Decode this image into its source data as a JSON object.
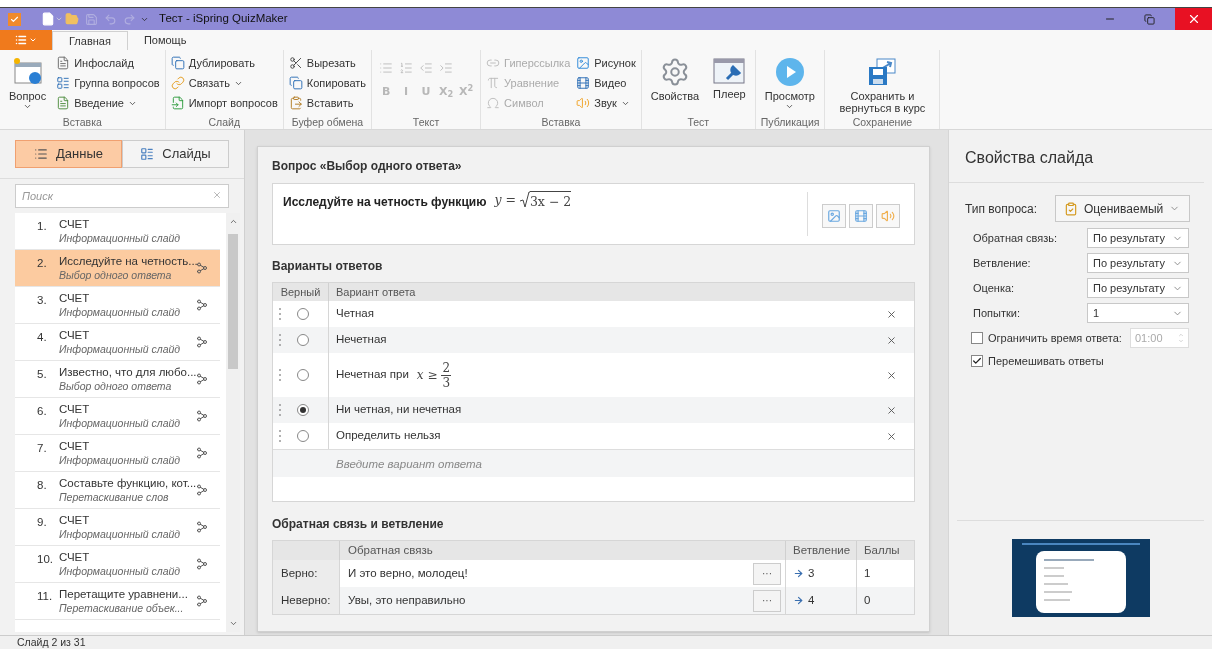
{
  "window": {
    "title": "Тест - iSpring QuizMaker"
  },
  "ribbon_tabs": [
    {
      "label": "Главная",
      "selected": true
    },
    {
      "label": "Помощь",
      "selected": false
    }
  ],
  "ribbon_groups": [
    {
      "label": "Вставка",
      "columns": [
        [
          {
            "kind": "large",
            "label": "Вопрос",
            "menu": true,
            "disabled": false
          }
        ],
        [
          {
            "kind": "small",
            "label": "Инфослайд",
            "menu": false,
            "disabled": false
          },
          {
            "kind": "small",
            "label": "Группа вопросов",
            "menu": false,
            "disabled": false
          },
          {
            "kind": "small",
            "label": "Введение",
            "menu": true,
            "disabled": false
          }
        ]
      ]
    },
    {
      "label": "Слайд",
      "columns": [
        [
          {
            "kind": "small",
            "label": "Дублировать",
            "menu": false,
            "disabled": false
          },
          {
            "kind": "small",
            "label": "Связать",
            "menu": true,
            "disabled": false
          },
          {
            "kind": "small",
            "label": "Импорт вопросов",
            "menu": false,
            "disabled": false
          }
        ]
      ]
    },
    {
      "label": "Буфер обмена",
      "columns": [
        [
          {
            "kind": "small",
            "label": "Вырезать",
            "menu": false,
            "disabled": false
          },
          {
            "kind": "small",
            "label": "Копировать",
            "menu": false,
            "disabled": false
          },
          {
            "kind": "small",
            "label": "Вставить",
            "menu": false,
            "disabled": false
          }
        ]
      ]
    },
    {
      "label": "Текст",
      "rows": [
        [
          {
            "kind": "icon",
            "disabled": true
          },
          {
            "kind": "icon",
            "disabled": true
          },
          {
            "kind": "icon",
            "disabled": true
          },
          {
            "kind": "icon",
            "disabled": true
          }
        ],
        [
          {
            "kind": "glyph",
            "label": "B",
            "disabled": true
          },
          {
            "kind": "glyph",
            "label": "I",
            "disabled": true
          },
          {
            "kind": "glyph",
            "label": "U",
            "disabled": true
          },
          {
            "kind": "glyph",
            "label": "X$_{2}$",
            "disabled": true
          },
          {
            "kind": "glyph",
            "label": "X$^{2}$",
            "disabled": true
          }
        ]
      ]
    },
    {
      "label": "Вставка",
      "columns": [
        [
          {
            "kind": "small",
            "label": "Гиперссылка",
            "menu": false,
            "disabled": true
          },
          {
            "kind": "small",
            "label": "Уравнение",
            "menu": false,
            "disabled": true
          },
          {
            "kind": "small",
            "label": "Символ",
            "menu": false,
            "disabled": true
          }
        ],
        [
          {
            "kind": "small",
            "label": "Рисунок",
            "menu": false,
            "disabled": false
          },
          {
            "kind": "small",
            "label": "Видео",
            "menu": false,
            "disabled": false
          },
          {
            "kind": "small",
            "label": "Звук",
            "menu": true,
            "disabled": false
          }
        ]
      ]
    },
    {
      "label": "Тест",
      "columns": [
        [
          {
            "kind": "large",
            "label": "Свойства",
            "menu": false,
            "disabled": false
          }
        ],
        [
          {
            "kind": "large",
            "label": "Плеер",
            "menu": false,
            "disabled": false
          }
        ]
      ]
    },
    {
      "label": "Публикация",
      "columns": [
        [
          {
            "kind": "large",
            "label": "Просмотр",
            "menu": true,
            "disabled": false
          }
        ]
      ]
    },
    {
      "label": "Сохранение",
      "columns": [
        [
          {
            "kind": "large",
            "label": "Сохранить и вернуться в курс",
            "menu": false,
            "disabled": false
          }
        ]
      ]
    }
  ],
  "left_tabs": [
    {
      "label": "Данные",
      "selected": true
    },
    {
      "label": "Слайды",
      "selected": false
    }
  ],
  "search": {
    "placeholder": "Поиск"
  },
  "slides": [
    {
      "number": "1.",
      "title": "СЧЕТ",
      "subtitle": "Информационный слайд",
      "selected": false,
      "branching": false
    },
    {
      "number": "2.",
      "title": "Исследуйте на четность...",
      "subtitle": "Выбор одного ответа",
      "selected": true,
      "branching": true
    },
    {
      "number": "3.",
      "title": "СЧЕТ",
      "subtitle": "Информационный слайд",
      "selected": false,
      "branching": true
    },
    {
      "number": "4.",
      "title": "СЧЕТ",
      "subtitle": "Информационный слайд",
      "selected": false,
      "branching": true
    },
    {
      "number": "5.",
      "title": "Известно, что для любо...",
      "subtitle": "Выбор одного ответа",
      "selected": false,
      "branching": true
    },
    {
      "number": "6.",
      "title": "СЧЕТ",
      "subtitle": "Информационный слайд",
      "selected": false,
      "branching": true
    },
    {
      "number": "7.",
      "title": "СЧЕТ",
      "subtitle": "Информационный слайд",
      "selected": false,
      "branching": true
    },
    {
      "number": "8.",
      "title": "Составьте функцию, кот...",
      "subtitle": "Перетаскивание слов",
      "selected": false,
      "branching": true
    },
    {
      "number": "9.",
      "title": "СЧЕТ",
      "subtitle": "Информационный слайд",
      "selected": false,
      "branching": true
    },
    {
      "number": "10.",
      "title": "СЧЕТ",
      "subtitle": "Информационный слайд",
      "selected": false,
      "branching": true
    },
    {
      "number": "11.",
      "title": "Перетащите уравнени...",
      "subtitle": "Перетаскивание объек...",
      "selected": false,
      "branching": true
    }
  ],
  "editor": {
    "title": "Вопрос «Выбор одного ответа»",
    "question": {
      "text": "Исследуйте на четность функцию",
      "formula": "y =",
      "radicand": "3x − 2"
    },
    "answers_title": "Варианты ответов",
    "answer_columns": [
      "Верный",
      "Вариант ответа"
    ],
    "answers": [
      {
        "kind": "text",
        "text": "Четная",
        "selected": false
      },
      {
        "kind": "text",
        "text": "Нечетная",
        "selected": false
      },
      {
        "kind": "fraction",
        "text": "Нечетная при",
        "formula": "x ≥",
        "numerator": "2",
        "denominator": "3",
        "selected": false
      },
      {
        "kind": "text",
        "text": "Ни четная, ни нечетная",
        "selected": true
      },
      {
        "kind": "text",
        "text": "Определить нельзя",
        "selected": false
      }
    ],
    "new_answer": {
      "placeholder": "Введите вариант ответа"
    },
    "feedback_title": "Обратная связь и ветвление",
    "feedback_columns": [
      "Обратная связь",
      "Ветвление",
      "Баллы"
    ],
    "feedback": [
      {
        "label": "Верно:",
        "text": "И это верно, молодец!",
        "branch": "3",
        "score": "1"
      },
      {
        "label": "Неверно:",
        "text": "Увы, это неправильно",
        "branch": "4",
        "score": "0"
      }
    ],
    "more_button": "···"
  },
  "properties": {
    "title": "Свойства слайда",
    "question_type": {
      "label": "Тип вопроса:",
      "value": "Оцениваемый"
    },
    "fields": [
      {
        "label": "Обратная связь:",
        "value": "По результату"
      },
      {
        "label": "Ветвление:",
        "value": "По результату"
      },
      {
        "label": "Оценка:",
        "value": "По результату"
      },
      {
        "label": "Попытки:",
        "value": "1"
      }
    ],
    "options": [
      {
        "kind": "timer",
        "label": "Ограничить время ответа:",
        "checked": false,
        "value": "01:00"
      },
      {
        "kind": "plain",
        "label": "Перемешивать ответы",
        "checked": true
      }
    ]
  },
  "status_bar": "Слайд 2 из 31"
}
